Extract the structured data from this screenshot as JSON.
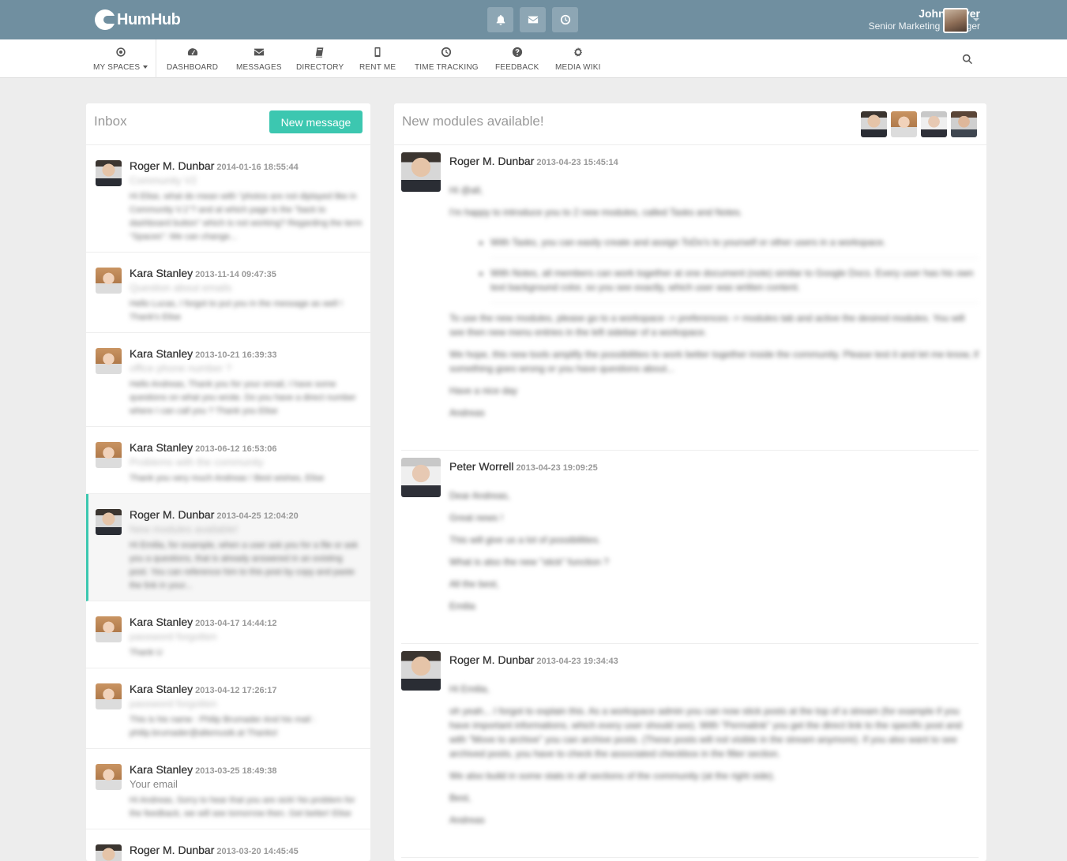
{
  "brand": {
    "name": "HumHub"
  },
  "topbar": {
    "user_name": "John Meyer",
    "user_title": "Senior Marketing Manager",
    "notifications": [
      {
        "icon": "bell-icon"
      },
      {
        "icon": "envelope-icon"
      },
      {
        "icon": "clock-icon"
      }
    ]
  },
  "nav": {
    "items": [
      {
        "label": "MY SPACES",
        "icon": "spaces-icon"
      },
      {
        "label": "DASHBOARD",
        "icon": "dashboard-icon"
      },
      {
        "label": "MESSAGES",
        "icon": "envelope-icon"
      },
      {
        "label": "DIRECTORY",
        "icon": "book-icon"
      },
      {
        "label": "RENT ME",
        "icon": "mobile-icon"
      },
      {
        "label": "TIME TRACKING",
        "icon": "clock-icon"
      },
      {
        "label": "FEEDBACK",
        "icon": "question-icon"
      },
      {
        "label": "MEDIA WIKI",
        "icon": "gear-icon"
      }
    ]
  },
  "inbox": {
    "title": "Inbox",
    "new_message_label": "New message",
    "items": [
      {
        "sender": "Roger M. Dunbar",
        "time": "2014-01-16 18:55:44",
        "subject": "Community V2",
        "preview": "Hi Elise, what do mean with \"photos are not diplayed like in Community V.1\"? and at which page is the \"back to dashboard button\" which is not working? Regarding the term \"Spaces\": We can change...",
        "active": false
      },
      {
        "sender": "Kara Stanley",
        "time": "2013-11-14 09:47:35",
        "subject": "Question about emails",
        "preview": "Hello Lucas, I forgot to put you in the message as well ! Thank's Elise",
        "active": false
      },
      {
        "sender": "Kara Stanley",
        "time": "2013-10-21 16:39:33",
        "subject": "office phone number ?",
        "preview": "Hello Andreas, Thank you for your email, I have some questions on what you wrote. Do you have a direct number where I can call you ? Thank you Elise",
        "active": false
      },
      {
        "sender": "Kara Stanley",
        "time": "2013-06-12 16:53:06",
        "subject": "Problems with the community",
        "preview": "Thank you very much Andreas ! Best wishes, Elise",
        "active": false
      },
      {
        "sender": "Roger M. Dunbar",
        "time": "2013-04-25 12:04:20",
        "subject": "New modules available!",
        "preview": "Hi Emilia, for example, when a user ask you for a file or ask you a questions, that is already answered in an existing post. You can reference him to this post by copy and paste the link in your...",
        "active": true
      },
      {
        "sender": "Kara Stanley",
        "time": "2013-04-17 14:44:12",
        "subject": "password forgotten",
        "preview": "Thank U",
        "active": false
      },
      {
        "sender": "Kara Stanley",
        "time": "2013-04-12 17:26:17",
        "subject": "password forgotten",
        "preview": "This is his name : Philip Brumader And his mail : philip.brumader@altemusik.at Thanks!",
        "active": false
      },
      {
        "sender": "Kara Stanley",
        "time": "2013-03-25 18:49:38",
        "subject": "Your email",
        "preview": "Hi Andreas, Sorry to hear that you are sick! No problem for the feedback, we will see tomorrow then. Get better! Elise",
        "active": false
      },
      {
        "sender": "Roger M. Dunbar",
        "time": "2013-03-20 14:45:45",
        "subject": "",
        "preview": "",
        "active": false
      }
    ]
  },
  "conversation": {
    "title": "New modules available!",
    "messages": [
      {
        "sender": "Roger M. Dunbar",
        "time": "2013-04-23 15:45:14",
        "intro": [
          "Hi @all,",
          "I'm happy to introduce you to 2 new modules, called Tasks and Notes."
        ],
        "bullets": [
          "With Tasks, you can easily create and assign ToDo's to yourself or other users in a workspace.",
          "With Notes, all members can work together at one document (note) similar to Google Docs. Every user has his own text background color, so you see exactly, which user was written content."
        ],
        "outro": [
          "To use the new modules, please go to a workspace -> preferences -> modules tab and active the desired modules. You will see then new menu entries in the left sidebar of a workspace.",
          "We hope, this new tools amplify the possibilities to work better together inside the community. Please test it and let me know, if something goes wrong or you have questions about...",
          "Have a nice day",
          "Andreas"
        ]
      },
      {
        "sender": "Peter Worrell",
        "time": "2013-04-23 19:09:25",
        "intro": [
          "Dear Andreas,",
          "Great news !",
          "This will give us a lot of possibilities.",
          "What is also the new \"stick\" function ?",
          "All the best,",
          "Emilia"
        ],
        "bullets": [],
        "outro": []
      },
      {
        "sender": "Roger M. Dunbar",
        "time": "2013-04-23 19:34:43",
        "intro": [
          "Hi Emilia,",
          "oh yeah... I forgot to explain this. As a workspace admin you can now stick posts at the top of a stream (for example if you have important informations, which every user should see). With \"Permalink\" you get the direct link to the specific post and with \"Move to archive\" you can archive posts. (These posts will not visible in the stream anymore). If you also want to see archived posts, you have to check the associated checkbox in the filter section.",
          "We also build in some stats in all sections of the community (at the right side).",
          "Best,",
          "Andreas"
        ],
        "bullets": [],
        "outro": []
      }
    ]
  },
  "colors": {
    "topbar": "#708fa0",
    "accent": "#3cc7b0"
  }
}
